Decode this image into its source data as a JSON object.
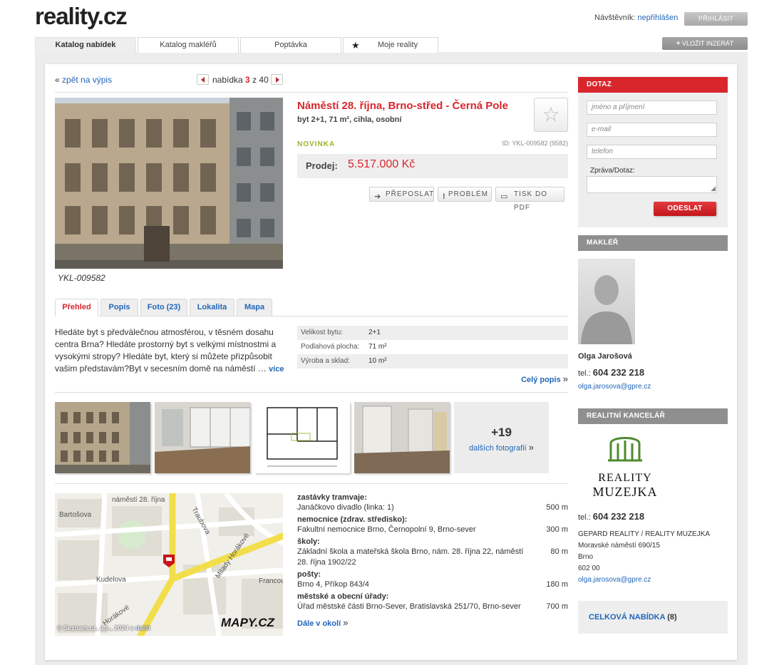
{
  "header": {
    "logo_text": "reality.cz",
    "visitor_label": "Návštěvník:",
    "visitor_status": "nepřihlášen",
    "login_button": "PŘIHLÁSIT",
    "insert_button": "VLOŽIT INZERÁT"
  },
  "nav": {
    "tabs": [
      {
        "label": "Katalog nabídek",
        "active": true
      },
      {
        "label": "Katalog makléřů",
        "active": false
      },
      {
        "label": "Poptávka",
        "active": false
      },
      {
        "label": "Moje reality",
        "active": false
      }
    ]
  },
  "pager": {
    "back_prefix": "«",
    "back_link": "zpět na výpis",
    "label": "nabídka",
    "current": "3",
    "of": "z",
    "total": "40"
  },
  "listing": {
    "photo_caption": "YKL-009582",
    "title": "Náměstí 28. října, Brno-střed - Černá Pole",
    "subtitle": "byt 2+1, 71 m², cihla, osobní",
    "badge": "NOVINKA",
    "id_text": "ID: YKL-009582 (9582)",
    "price_label": "Prodej:",
    "price_value": "5.517.000 Kč",
    "actions": [
      "PŘEPOSLAT",
      "PROBLÉM",
      "TISK DO PDF"
    ]
  },
  "content_tabs": [
    {
      "label": "Přehled",
      "active": true
    },
    {
      "label": "Popis",
      "active": false
    },
    {
      "label": "Foto (23)",
      "active": false
    },
    {
      "label": "Lokalita",
      "active": false
    },
    {
      "label": "Mapa",
      "active": false
    }
  ],
  "description": {
    "text": "Hledáte byt s předválečnou atmosférou, v těsném dosahu centra Brna? Hledáte prostorný byt s velkými místnostmi a vysokými stropy? Hledáte byt, který si můžete přizpůsobit vašim představám?Byt v secesním domě na náměstí …",
    "more_link": "více",
    "full_link": "Celý popis",
    "full_suffix": "»"
  },
  "params": [
    {
      "key": "Velikost bytu:",
      "value": "2+1"
    },
    {
      "key": "Podlahová plocha:",
      "value": "71 m²"
    },
    {
      "key": "Výroba a sklad:",
      "value": "10 m²"
    }
  ],
  "gallery": {
    "more_count": "+19",
    "more_label": "dalších fotografií",
    "more_suffix": "»"
  },
  "map": {
    "copyright": "© Seznam.cz, a.s., 2024 a",
    "copyright_link": "další",
    "logo": "MAPY.CZ",
    "streets": [
      "náměstí 28. října",
      "Bartošova",
      "Traubova",
      "Kudelova",
      "Milady Horákové",
      "Francouzská",
      "Horákové"
    ]
  },
  "poi": [
    {
      "category": "zastávky tramvaje:",
      "name": "Janáčkovo divadlo (linka: 1)",
      "distance": "500 m"
    },
    {
      "category": "nemocnice (zdrav. středisko):",
      "name": "Fakultní nemocnice Brno, Černopolní 9, Brno-sever",
      "distance": "300 m"
    },
    {
      "category": "školy:",
      "name": "Základní škola a mateřská škola Brno, nám. 28. října 22, náměstí 28. října 1902/22",
      "distance": "80 m"
    },
    {
      "category": "pošty:",
      "name": "Brno 4, Příkop 843/4",
      "distance": "180 m"
    },
    {
      "category": "městské a obecní úřady:",
      "name": "Úřad městské části Brno-Sever, Bratislavská 251/70, Brno-sever",
      "distance": "700 m"
    }
  ],
  "poi_more": {
    "label": "Dále v okolí",
    "suffix": "»"
  },
  "inquiry": {
    "title": "DOTAZ",
    "name_placeholder": "jméno a příjmení",
    "email_placeholder": "e-mail",
    "phone_placeholder": "telefon",
    "message_label": "Zpráva/Dotaz:",
    "send_button": "ODESLAT"
  },
  "agent": {
    "title": "MAKLÉŘ",
    "name": "Olga Jarošová",
    "tel_label": "tel.:",
    "tel": "604 232 218",
    "email": "olga.jarosova@gpre.cz"
  },
  "agency": {
    "title": "REALITNÍ KANCELÁŘ",
    "logo_line1": "REALITY",
    "logo_line2": "MUZEJKA",
    "tel_label": "tel.:",
    "tel": "604 232 218",
    "name": "GEPARD REALITY / REALITY MUZEJKA",
    "street": "Moravské náměstí 690/15",
    "city": "Brno",
    "zip": "602 00",
    "email": "olga.jarosova@gpre.cz",
    "all_offers_label": "CELKOVÁ NABÍDKA",
    "all_offers_count": "(8)"
  },
  "colors": {
    "accent_red": "#d8262c",
    "link_blue": "#2266b8",
    "novinka_green": "#9bb52a"
  }
}
